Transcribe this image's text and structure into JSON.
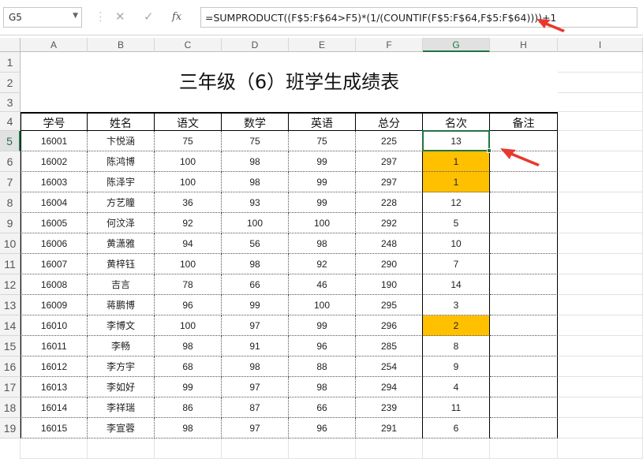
{
  "formula_bar": {
    "name_box": "G5",
    "formula": "=SUMPRODUCT((F$5:F$64>F5)*(1/(COUNTIF(F$5:F$64,F$5:F$64))))+1",
    "fx_label": "fx"
  },
  "columns": [
    "A",
    "B",
    "C",
    "D",
    "E",
    "F",
    "G",
    "H",
    "I"
  ],
  "row_numbers": [
    "1",
    "2",
    "3",
    "4",
    "5",
    "6",
    "7",
    "8",
    "9",
    "10",
    "11",
    "12",
    "13",
    "14",
    "15",
    "16",
    "17",
    "18",
    "19"
  ],
  "sheet_title": "三年级（6）班学生成绩表",
  "headers": [
    "学号",
    "姓名",
    "语文",
    "数学",
    "英语",
    "总分",
    "名次",
    "备注"
  ],
  "rows": [
    [
      "16001",
      "卞悦涵",
      "75",
      "75",
      "75",
      "225",
      "13",
      ""
    ],
    [
      "16002",
      "陈鸿博",
      "100",
      "98",
      "99",
      "297",
      "1",
      ""
    ],
    [
      "16003",
      "陈泽宇",
      "100",
      "98",
      "99",
      "297",
      "1",
      ""
    ],
    [
      "16004",
      "方艺瞳",
      "36",
      "93",
      "99",
      "228",
      "12",
      ""
    ],
    [
      "16005",
      "何汶泽",
      "92",
      "100",
      "100",
      "292",
      "5",
      ""
    ],
    [
      "16006",
      "黄潇雅",
      "94",
      "56",
      "98",
      "248",
      "10",
      ""
    ],
    [
      "16007",
      "黄梓钰",
      "100",
      "98",
      "92",
      "290",
      "7",
      ""
    ],
    [
      "16008",
      "吉言",
      "78",
      "66",
      "46",
      "190",
      "14",
      ""
    ],
    [
      "16009",
      "蒋鹏博",
      "96",
      "99",
      "100",
      "295",
      "3",
      ""
    ],
    [
      "16010",
      "李博文",
      "100",
      "97",
      "99",
      "296",
      "2",
      ""
    ],
    [
      "16011",
      "李畅",
      "98",
      "91",
      "96",
      "285",
      "8",
      ""
    ],
    [
      "16012",
      "李方宇",
      "68",
      "98",
      "88",
      "254",
      "9",
      ""
    ],
    [
      "16013",
      "李如好",
      "99",
      "97",
      "98",
      "294",
      "4",
      ""
    ],
    [
      "16014",
      "李祥瑞",
      "86",
      "87",
      "66",
      "239",
      "11",
      ""
    ],
    [
      "16015",
      "李宣蓉",
      "98",
      "97",
      "96",
      "291",
      "6",
      ""
    ]
  ],
  "colors": {
    "highlight": "#ffc000",
    "selection": "#217346",
    "arrow": "#e8382e"
  }
}
